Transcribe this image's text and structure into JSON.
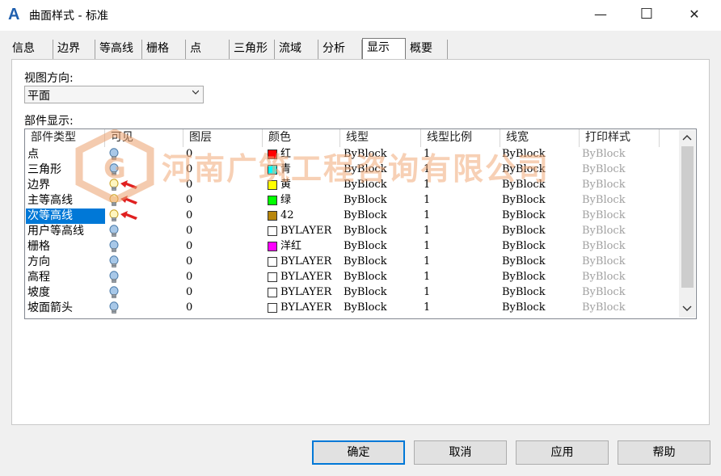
{
  "window": {
    "title": "曲面样式 - 标准",
    "logo_letter": "A",
    "minimize": "—",
    "maximize": "☐",
    "close": "✕"
  },
  "tabs": [
    "信息",
    "边界",
    "等高线",
    "栅格",
    "点",
    "三角形",
    "流域",
    "分析",
    "显示",
    "概要"
  ],
  "active_tab": "显示",
  "view_direction": {
    "label": "视图方向:",
    "value": "平面"
  },
  "component_display": {
    "label": "部件显示:",
    "columns": [
      "部件类型",
      "可见",
      "图层",
      "颜色",
      "线型",
      "线型比例",
      "线宽",
      "打印样式"
    ],
    "rows": [
      {
        "type": "点",
        "visible": true,
        "layer": "0",
        "color_name": "红",
        "color_hex": "#ff0000",
        "linetype": "ByBlock",
        "scale": "1",
        "lineweight": "ByBlock",
        "plot": "ByBlock"
      },
      {
        "type": "三角形",
        "visible": true,
        "layer": "0",
        "color_name": "青",
        "color_hex": "#00ffff",
        "linetype": "ByBlock",
        "scale": "1",
        "lineweight": "ByBlock",
        "plot": "ByBlock"
      },
      {
        "type": "边界",
        "visible": false,
        "layer": "0",
        "color_name": "黄",
        "color_hex": "#ffff00",
        "linetype": "ByBlock",
        "scale": "1",
        "lineweight": "ByBlock",
        "plot": "ByBlock"
      },
      {
        "type": "主等高线",
        "visible": false,
        "layer": "0",
        "color_name": "绿",
        "color_hex": "#00ff00",
        "linetype": "ByBlock",
        "scale": "1",
        "lineweight": "ByBlock",
        "plot": "ByBlock"
      },
      {
        "type": "次等高线",
        "visible": false,
        "layer": "0",
        "color_name": "42",
        "color_hex": "#b8860b",
        "linetype": "ByBlock",
        "scale": "1",
        "lineweight": "ByBlock",
        "plot": "ByBlock"
      },
      {
        "type": "用户等高线",
        "visible": true,
        "layer": "0",
        "color_name": "BYLAYER",
        "color_hex": "#ffffff",
        "linetype": "ByBlock",
        "scale": "1",
        "lineweight": "ByBlock",
        "plot": "ByBlock"
      },
      {
        "type": "栅格",
        "visible": true,
        "layer": "0",
        "color_name": "洋红",
        "color_hex": "#ff00ff",
        "linetype": "ByBlock",
        "scale": "1",
        "lineweight": "ByBlock",
        "plot": "ByBlock"
      },
      {
        "type": "方向",
        "visible": true,
        "layer": "0",
        "color_name": "BYLAYER",
        "color_hex": "#ffffff",
        "linetype": "ByBlock",
        "scale": "1",
        "lineweight": "ByBlock",
        "plot": "ByBlock"
      },
      {
        "type": "高程",
        "visible": true,
        "layer": "0",
        "color_name": "BYLAYER",
        "color_hex": "#ffffff",
        "linetype": "ByBlock",
        "scale": "1",
        "lineweight": "ByBlock",
        "plot": "ByBlock"
      },
      {
        "type": "坡度",
        "visible": true,
        "layer": "0",
        "color_name": "BYLAYER",
        "color_hex": "#ffffff",
        "linetype": "ByBlock",
        "scale": "1",
        "lineweight": "ByBlock",
        "plot": "ByBlock"
      },
      {
        "type": "坡面箭头",
        "visible": true,
        "layer": "0",
        "color_name": "BYLAYER",
        "color_hex": "#ffffff",
        "linetype": "ByBlock",
        "scale": "1",
        "lineweight": "ByBlock",
        "plot": "ByBlock"
      }
    ],
    "selected_row": 4,
    "highlighted_rows": [
      2,
      3,
      4
    ]
  },
  "watermark": "河南广筑工程咨询有限公司",
  "buttons": {
    "ok": "确定",
    "cancel": "取消",
    "apply": "应用",
    "help": "帮助"
  },
  "colors": {
    "accent": "#0078d7",
    "plot_style_text": "#a0a0a0",
    "arrow": "#e02020"
  }
}
